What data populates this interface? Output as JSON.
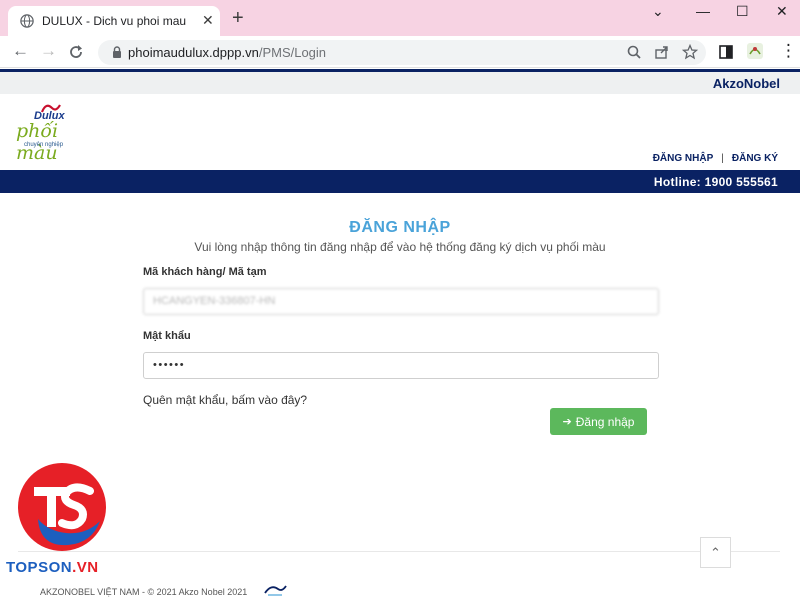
{
  "browser": {
    "tab_title": "DULUX - Dich vu phoi mau",
    "new_tab_symbol": "+",
    "close_tab_symbol": "✕",
    "url_host": "phoimaudulux.dppp.vn",
    "url_path": "/PMS/Login",
    "window_controls": {
      "minimize": "⌄",
      "restore": "—",
      "maximize": "☐",
      "close": "✕"
    }
  },
  "site": {
    "brand": "AkzoNobel",
    "logo": {
      "dulux": "Dulux",
      "phoi_mau": "phối màu",
      "tagline": "chuyên nghiệp"
    },
    "links": {
      "login": "ĐĂNG NHẬP",
      "separator": "|",
      "register": "ĐĂNG KÝ"
    },
    "hotline": "Hotline: 1900 555561"
  },
  "login": {
    "title": "ĐĂNG NHẬP",
    "subtitle": "Vui lòng nhập thông tin đăng nhập để vào hệ thống đăng ký dịch vụ phối màu",
    "customer_label": "Mã khách hàng/ Mã tạm",
    "customer_value": "HCANGYEN-336807-HN",
    "password_label": "Mật khẩu",
    "password_value": "••••••",
    "forgot": "Quên mật khẩu, bấm vào đây?",
    "submit": "Đăng nhập"
  },
  "footer": {
    "copyright": "AKZONOBEL VIỆT NAM - © 2021 Akzo Nobel 2021"
  },
  "watermark": {
    "text_main": "TOPSON",
    "text_tld": ".VN"
  },
  "colors": {
    "navy": "#0a2263",
    "title_blue": "#4aa3d9",
    "button_green": "#5cb85c",
    "tab_strip_pink": "#f7d3e3"
  }
}
